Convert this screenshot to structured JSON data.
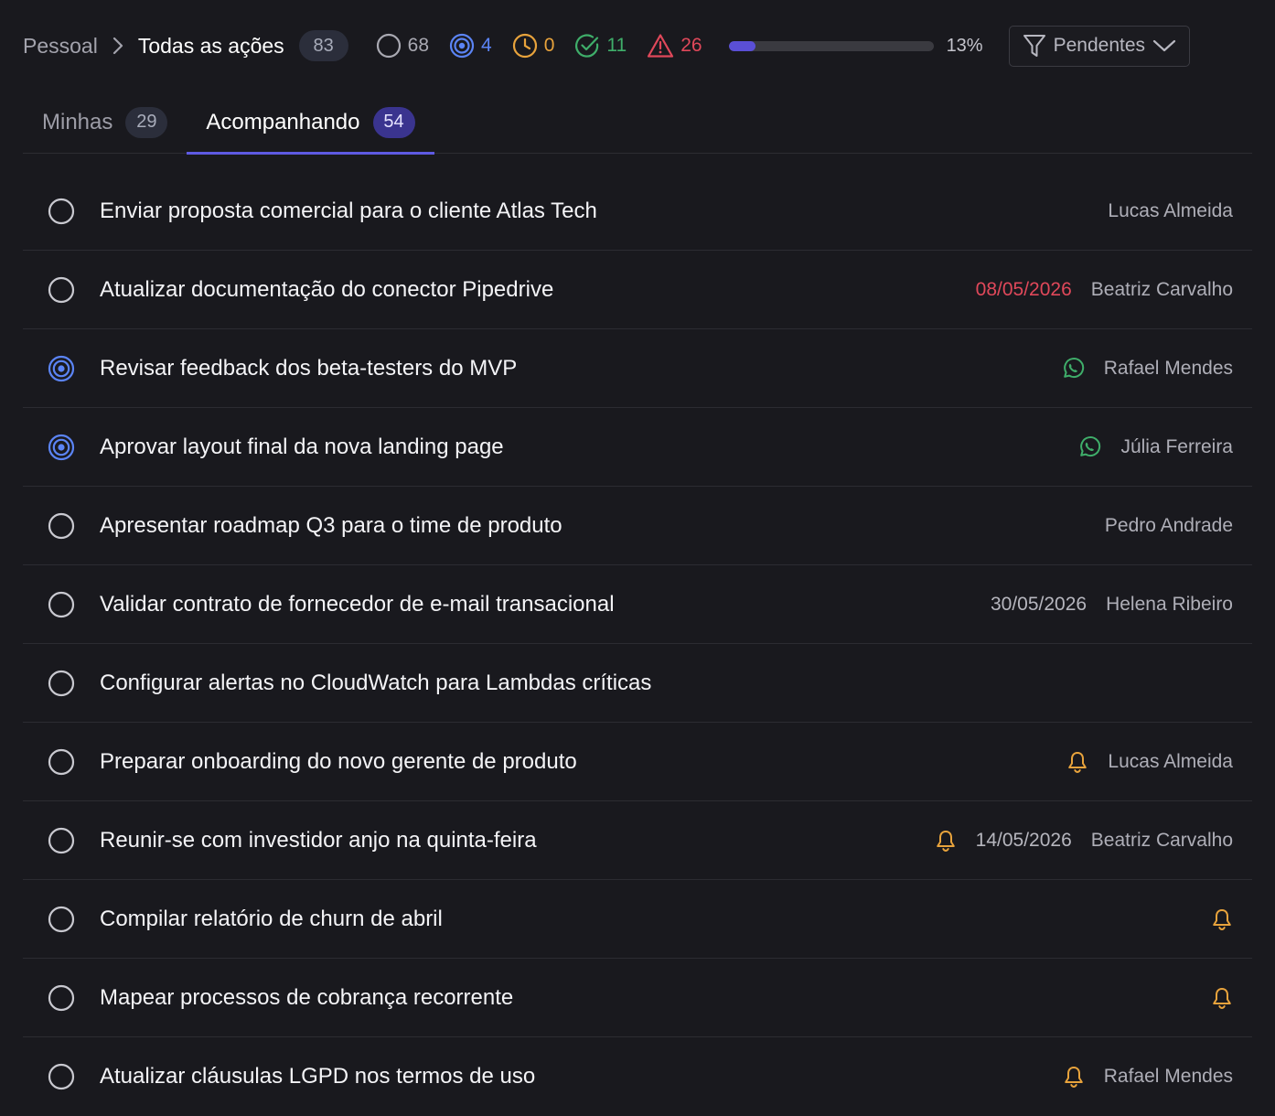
{
  "header": {
    "breadcrumb_root": "Pessoal",
    "breadcrumb_current": "Todas as ações",
    "total_count": "83",
    "stats": {
      "open": "68",
      "in_progress": "4",
      "waiting": "0",
      "done": "11",
      "overdue": "26"
    },
    "progress_percent": 13,
    "progress_label": "13%",
    "filter_label": "Pendentes"
  },
  "tabs": [
    {
      "label": "Minhas",
      "count": "29",
      "active": false
    },
    {
      "label": "Acompanhando",
      "count": "54",
      "active": true
    }
  ],
  "colors": {
    "accent": "#5e5ae3",
    "in_progress": "#5b84f5",
    "waiting": "#e8a33c",
    "done": "#3fae6a",
    "overdue": "#e0485a",
    "whatsapp": "#3fae6a"
  },
  "tasks": [
    {
      "title": "Enviar proposta comercial para o cliente Atlas Tech",
      "status": "open",
      "date": "",
      "overdue": false,
      "icon": "",
      "person": "Lucas Almeida"
    },
    {
      "title": "Atualizar documentação do conector Pipedrive",
      "status": "open",
      "date": "08/05/2026",
      "overdue": true,
      "icon": "",
      "person": "Beatriz Carvalho"
    },
    {
      "title": "Revisar feedback dos beta-testers do MVP",
      "status": "in_progress",
      "date": "",
      "overdue": false,
      "icon": "whatsapp-icon",
      "person": "Rafael Mendes"
    },
    {
      "title": "Aprovar layout final da nova landing page",
      "status": "in_progress",
      "date": "",
      "overdue": false,
      "icon": "whatsapp-icon",
      "person": "Júlia Ferreira"
    },
    {
      "title": "Apresentar roadmap Q3 para o time de produto",
      "status": "open",
      "date": "",
      "overdue": false,
      "icon": "",
      "person": "Pedro Andrade"
    },
    {
      "title": "Validar contrato de fornecedor de e-mail transacional",
      "status": "open",
      "date": "30/05/2026",
      "overdue": false,
      "icon": "",
      "person": "Helena Ribeiro"
    },
    {
      "title": "Configurar alertas no CloudWatch para Lambdas críticas",
      "status": "open",
      "date": "",
      "overdue": false,
      "icon": "",
      "person": ""
    },
    {
      "title": "Preparar onboarding do novo gerente de produto",
      "status": "open",
      "date": "",
      "overdue": false,
      "icon": "bell-icon",
      "person": "Lucas Almeida"
    },
    {
      "title": "Reunir-se com investidor anjo na quinta-feira",
      "status": "open",
      "date": "14/05/2026",
      "overdue": false,
      "icon": "bell-icon",
      "person": "Beatriz Carvalho"
    },
    {
      "title": "Compilar relatório de churn de abril",
      "status": "open",
      "date": "",
      "overdue": false,
      "icon": "bell-icon",
      "person": ""
    },
    {
      "title": "Mapear processos de cobrança recorrente",
      "status": "open",
      "date": "",
      "overdue": false,
      "icon": "bell-icon",
      "person": ""
    },
    {
      "title": "Atualizar cláusulas LGPD nos termos de uso",
      "status": "open",
      "date": "",
      "overdue": false,
      "icon": "bell-icon",
      "person": "Rafael Mendes"
    }
  ]
}
